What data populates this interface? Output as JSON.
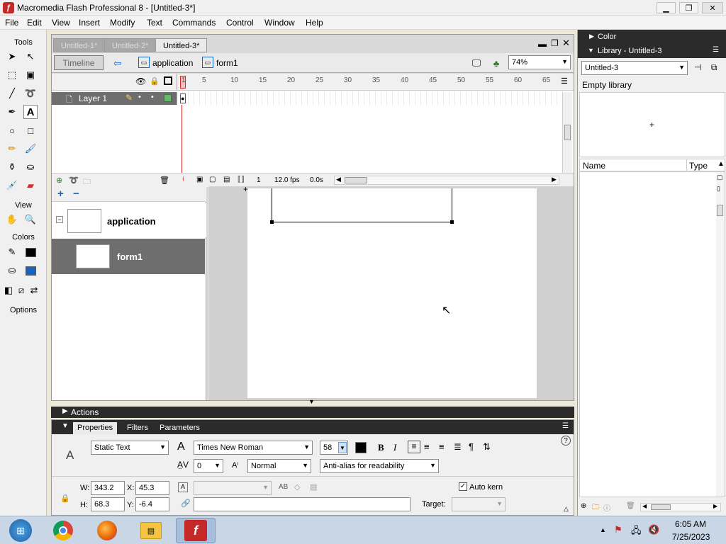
{
  "window": {
    "title": "Macromedia Flash Professional 8 - [Untitled-3*]",
    "controls": [
      "minimize-icon",
      "restore-icon",
      "close-icon"
    ]
  },
  "menu": [
    "File",
    "Edit",
    "View",
    "Insert",
    "Modify",
    "Text",
    "Commands",
    "Control",
    "Window",
    "Help"
  ],
  "tools": {
    "title": "Tools",
    "view_label": "View",
    "colors_label": "Colors",
    "options_label": "Options"
  },
  "document": {
    "tabs": [
      "Untitled-1*",
      "Untitled-2*",
      "Untitled-3*"
    ],
    "active_tab": 2,
    "timeline_button": "Timeline",
    "breadcrumb": [
      "application",
      "form1"
    ],
    "zoom": "74%"
  },
  "timeline": {
    "layer_name": "Layer 1",
    "ruler_ticks": [
      "1",
      "5",
      "10",
      "15",
      "20",
      "25",
      "30",
      "35",
      "40",
      "45",
      "50",
      "55",
      "60",
      "65"
    ],
    "current_frame": "1",
    "frame_rate": "12.0 fps",
    "elapsed": "0.0s"
  },
  "tree": {
    "items": [
      {
        "label": "application",
        "selected": false
      },
      {
        "label": "form1",
        "selected": true
      }
    ]
  },
  "panels": {
    "actions_label": "Actions"
  },
  "properties": {
    "tabs": [
      "Properties",
      "Filters",
      "Parameters"
    ],
    "text_type": "Static Text",
    "font": "Times New Roman",
    "font_size": "58",
    "letter_spacing": "0",
    "char_position": "Normal",
    "antialias": "Anti-alias for readability",
    "auto_kern_label": "Auto kern",
    "auto_kern": true,
    "target_label": "Target:",
    "w_label": "W:",
    "w": "343.2",
    "x_label": "X:",
    "x": "45.3",
    "h_label": "H:",
    "h": "68.3",
    "y_label": "Y:",
    "y": "-6.4"
  },
  "right": {
    "color_panel": "Color",
    "library_panel": "Library - Untitled-3",
    "library_select": "Untitled-3",
    "empty_text": "Empty library",
    "col_name": "Name",
    "col_type": "Type"
  },
  "taskbar": {
    "time": "6:05 AM",
    "date": "7/25/2023"
  },
  "colors": {
    "brand_red": "#c62828",
    "stroke_color": "#000000",
    "fill_color": "#1565c0"
  }
}
